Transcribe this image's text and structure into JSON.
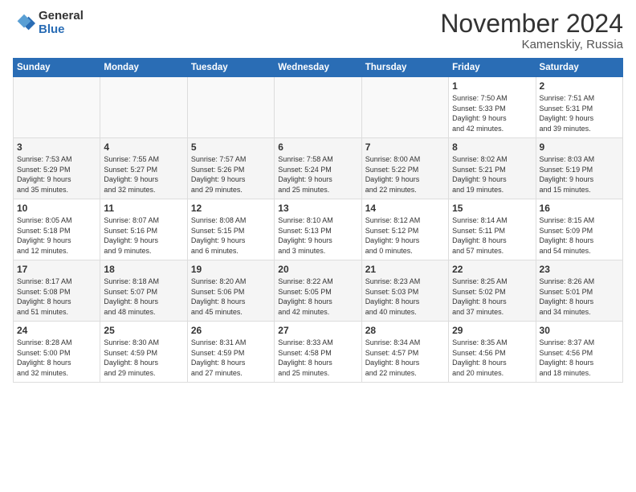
{
  "logo": {
    "general": "General",
    "blue": "Blue"
  },
  "title": "November 2024",
  "location": "Kamenskiy, Russia",
  "days_of_week": [
    "Sunday",
    "Monday",
    "Tuesday",
    "Wednesday",
    "Thursday",
    "Friday",
    "Saturday"
  ],
  "weeks": [
    [
      {
        "day": "",
        "detail": ""
      },
      {
        "day": "",
        "detail": ""
      },
      {
        "day": "",
        "detail": ""
      },
      {
        "day": "",
        "detail": ""
      },
      {
        "day": "",
        "detail": ""
      },
      {
        "day": "1",
        "detail": "Sunrise: 7:50 AM\nSunset: 5:33 PM\nDaylight: 9 hours\nand 42 minutes."
      },
      {
        "day": "2",
        "detail": "Sunrise: 7:51 AM\nSunset: 5:31 PM\nDaylight: 9 hours\nand 39 minutes."
      }
    ],
    [
      {
        "day": "3",
        "detail": "Sunrise: 7:53 AM\nSunset: 5:29 PM\nDaylight: 9 hours\nand 35 minutes."
      },
      {
        "day": "4",
        "detail": "Sunrise: 7:55 AM\nSunset: 5:27 PM\nDaylight: 9 hours\nand 32 minutes."
      },
      {
        "day": "5",
        "detail": "Sunrise: 7:57 AM\nSunset: 5:26 PM\nDaylight: 9 hours\nand 29 minutes."
      },
      {
        "day": "6",
        "detail": "Sunrise: 7:58 AM\nSunset: 5:24 PM\nDaylight: 9 hours\nand 25 minutes."
      },
      {
        "day": "7",
        "detail": "Sunrise: 8:00 AM\nSunset: 5:22 PM\nDaylight: 9 hours\nand 22 minutes."
      },
      {
        "day": "8",
        "detail": "Sunrise: 8:02 AM\nSunset: 5:21 PM\nDaylight: 9 hours\nand 19 minutes."
      },
      {
        "day": "9",
        "detail": "Sunrise: 8:03 AM\nSunset: 5:19 PM\nDaylight: 9 hours\nand 15 minutes."
      }
    ],
    [
      {
        "day": "10",
        "detail": "Sunrise: 8:05 AM\nSunset: 5:18 PM\nDaylight: 9 hours\nand 12 minutes."
      },
      {
        "day": "11",
        "detail": "Sunrise: 8:07 AM\nSunset: 5:16 PM\nDaylight: 9 hours\nand 9 minutes."
      },
      {
        "day": "12",
        "detail": "Sunrise: 8:08 AM\nSunset: 5:15 PM\nDaylight: 9 hours\nand 6 minutes."
      },
      {
        "day": "13",
        "detail": "Sunrise: 8:10 AM\nSunset: 5:13 PM\nDaylight: 9 hours\nand 3 minutes."
      },
      {
        "day": "14",
        "detail": "Sunrise: 8:12 AM\nSunset: 5:12 PM\nDaylight: 9 hours\nand 0 minutes."
      },
      {
        "day": "15",
        "detail": "Sunrise: 8:14 AM\nSunset: 5:11 PM\nDaylight: 8 hours\nand 57 minutes."
      },
      {
        "day": "16",
        "detail": "Sunrise: 8:15 AM\nSunset: 5:09 PM\nDaylight: 8 hours\nand 54 minutes."
      }
    ],
    [
      {
        "day": "17",
        "detail": "Sunrise: 8:17 AM\nSunset: 5:08 PM\nDaylight: 8 hours\nand 51 minutes."
      },
      {
        "day": "18",
        "detail": "Sunrise: 8:18 AM\nSunset: 5:07 PM\nDaylight: 8 hours\nand 48 minutes."
      },
      {
        "day": "19",
        "detail": "Sunrise: 8:20 AM\nSunset: 5:06 PM\nDaylight: 8 hours\nand 45 minutes."
      },
      {
        "day": "20",
        "detail": "Sunrise: 8:22 AM\nSunset: 5:05 PM\nDaylight: 8 hours\nand 42 minutes."
      },
      {
        "day": "21",
        "detail": "Sunrise: 8:23 AM\nSunset: 5:03 PM\nDaylight: 8 hours\nand 40 minutes."
      },
      {
        "day": "22",
        "detail": "Sunrise: 8:25 AM\nSunset: 5:02 PM\nDaylight: 8 hours\nand 37 minutes."
      },
      {
        "day": "23",
        "detail": "Sunrise: 8:26 AM\nSunset: 5:01 PM\nDaylight: 8 hours\nand 34 minutes."
      }
    ],
    [
      {
        "day": "24",
        "detail": "Sunrise: 8:28 AM\nSunset: 5:00 PM\nDaylight: 8 hours\nand 32 minutes."
      },
      {
        "day": "25",
        "detail": "Sunrise: 8:30 AM\nSunset: 4:59 PM\nDaylight: 8 hours\nand 29 minutes."
      },
      {
        "day": "26",
        "detail": "Sunrise: 8:31 AM\nSunset: 4:59 PM\nDaylight: 8 hours\nand 27 minutes."
      },
      {
        "day": "27",
        "detail": "Sunrise: 8:33 AM\nSunset: 4:58 PM\nDaylight: 8 hours\nand 25 minutes."
      },
      {
        "day": "28",
        "detail": "Sunrise: 8:34 AM\nSunset: 4:57 PM\nDaylight: 8 hours\nand 22 minutes."
      },
      {
        "day": "29",
        "detail": "Sunrise: 8:35 AM\nSunset: 4:56 PM\nDaylight: 8 hours\nand 20 minutes."
      },
      {
        "day": "30",
        "detail": "Sunrise: 8:37 AM\nSunset: 4:56 PM\nDaylight: 8 hours\nand 18 minutes."
      }
    ]
  ]
}
